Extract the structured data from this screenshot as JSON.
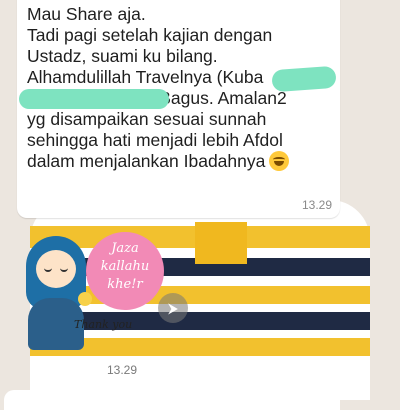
{
  "message": {
    "lines": [
      "Mau Share aja.",
      "Tadi pagi setelah kajian dengan",
      "Ustadz, suami ku bilang.",
      "Alhamdulillah Travelnya (Kuba",
      "                         ) Bagus. Amalan2",
      "yg disampaikan sesuai sunnah",
      "sehingga hati menjadi lebih Afdol",
      "dalam menjalankan Ibadahnya"
    ],
    "emoji": "smiling-face",
    "time": "13.29"
  },
  "sticker": {
    "line1": "Jaza",
    "line2": "kallahu",
    "line3": "khe!r",
    "caption": "Thank you"
  },
  "sticker_time": "13.29",
  "forward_icon_glyph": "⮞"
}
